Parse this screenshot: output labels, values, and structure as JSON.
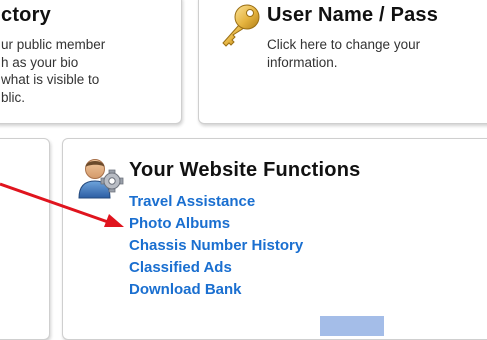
{
  "directory_panel": {
    "title": "ctory",
    "description_lines": [
      "ur public member",
      "h as your bio",
      "what is visible to",
      "blic."
    ]
  },
  "user_panel": {
    "title": "User Name / Pass",
    "description_lines": [
      "Click here to change your",
      "information."
    ],
    "icon": "key-icon"
  },
  "functions_panel": {
    "title": "Your Website Functions",
    "icon": "user-settings-icon",
    "links": [
      "Travel Assistance",
      "Photo Albums",
      "Chassis Number History",
      "Classified Ads",
      "Download Bank"
    ]
  },
  "annotation": {
    "type": "arrow",
    "color": "#e0141e",
    "points_to": "Photo Albums"
  },
  "colors": {
    "link": "#1a6fd0",
    "panel_border": "#cfcfcf",
    "tab": "#a4bde8"
  }
}
